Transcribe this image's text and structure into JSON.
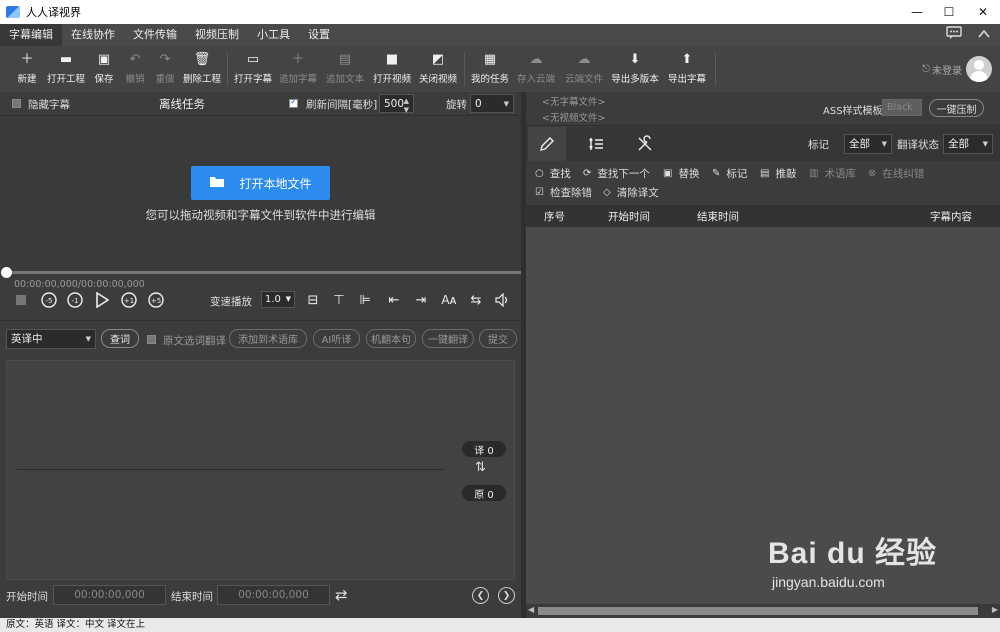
{
  "window": {
    "title": "人人译视界",
    "min": "—",
    "max": "☐",
    "close": "✕"
  },
  "menu": {
    "items": [
      "字幕编辑",
      "在线协作",
      "文件传输",
      "视频压制",
      "小工具",
      "设置"
    ],
    "chat_icon": "chat-icon",
    "collapse_icon": "chevron-up-icon"
  },
  "toolbar": {
    "buttons": [
      {
        "label": "新建",
        "icon": "＋"
      },
      {
        "label": "打开工程",
        "icon": "▬"
      },
      {
        "label": "保存",
        "icon": "▣"
      },
      {
        "label": "撤销",
        "icon": "↶"
      },
      {
        "label": "重做",
        "icon": "↷"
      },
      {
        "label": "删除工程",
        "icon": "🗑"
      },
      {
        "label": "打开字幕",
        "icon": "▭"
      },
      {
        "label": "追加字幕",
        "icon": "＋"
      },
      {
        "label": "追加文本",
        "icon": "▤"
      },
      {
        "label": "打开视频",
        "icon": "■"
      },
      {
        "label": "关闭视频",
        "icon": "◩"
      },
      {
        "label": "我的任务",
        "icon": "▦"
      },
      {
        "label": "存入云端",
        "icon": "☁"
      },
      {
        "label": "云端文件",
        "icon": "☁"
      },
      {
        "label": "导出多版本",
        "icon": "⬇"
      },
      {
        "label": "导出字幕",
        "icon": "⬆"
      }
    ],
    "login_label": "未登录"
  },
  "left": {
    "hide_sub_label": "隐藏字幕",
    "offline_task": "离线任务",
    "refresh_label": "刷新间隔[毫秒]",
    "refresh_value": "500",
    "rotate_label": "旋转",
    "rotate_value": "0",
    "open_local_file": "打开本地文件",
    "drag_hint": "您可以拖动视频和字幕文件到软件中进行编辑",
    "timecode": "00:00:00,000/00:00:00,000",
    "speed_label": "变速播放",
    "speed_value": "1.0",
    "lang_pair": "英译中",
    "query_btn": "查词",
    "source_select_translate": "原文选词翻译",
    "pills": [
      "添加到术语库",
      "AI听译",
      "机翻本句",
      "一键翻译",
      "提交"
    ],
    "trans_counter": "译 0",
    "orig_counter": "原 0",
    "start_time_label": "开始时间",
    "start_time_value": "00:00:00,000",
    "end_time_label": "结束时间",
    "end_time_value": "00:00:00,000"
  },
  "right": {
    "no_sub_file": "<无字幕文件>",
    "no_video_file": "<无视频文件>",
    "ass_label": "ASS样式模板",
    "ass_value": "Black",
    "one_click_press": "一键压制",
    "mark_label": "标记",
    "mark_value": "全部",
    "trans_status_label": "翻译状态",
    "trans_status_value": "全部",
    "actions_row1": [
      "查找",
      "查找下一个",
      "替换",
      "标记",
      "推敲",
      "术语库",
      "在线纠错"
    ],
    "actions_row2": [
      "检查除错",
      "清除译文"
    ],
    "columns": [
      "序号",
      "开始时间",
      "结束时间",
      "字幕内容"
    ]
  },
  "statusbar": {
    "text": "原文：英语 译文：中文   译文在上"
  },
  "watermark": {
    "main": "Bai du 经验",
    "sub": "jingyan.baidu.com"
  }
}
